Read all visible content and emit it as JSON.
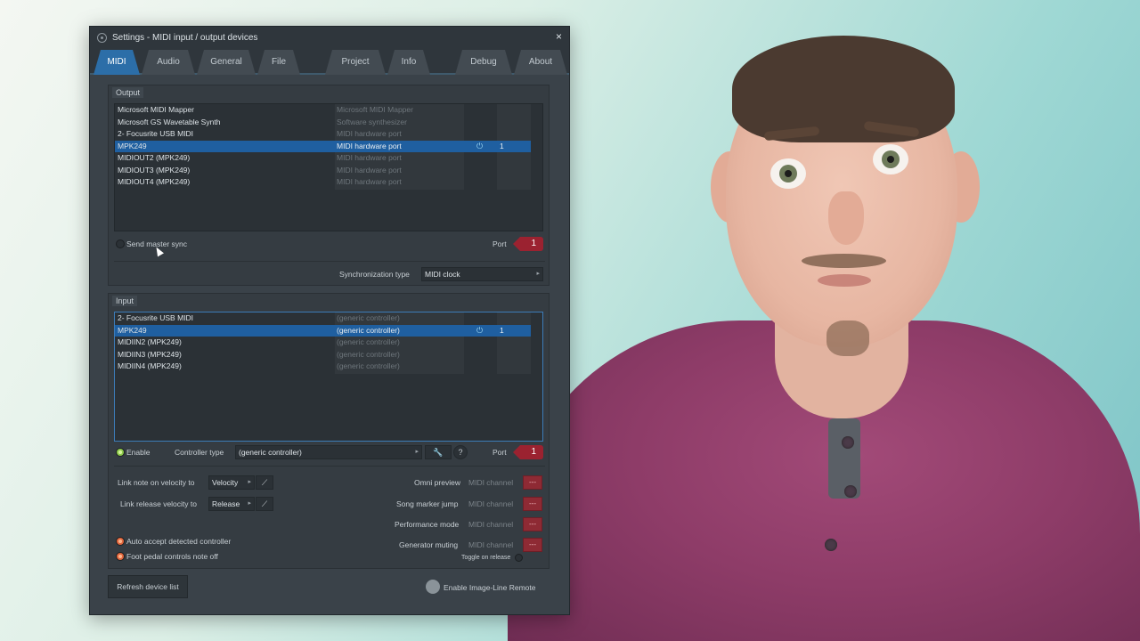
{
  "window": {
    "title": "Settings - MIDI input / output devices",
    "close_glyph": "×"
  },
  "tabs": [
    "MIDI",
    "Audio",
    "General",
    "File",
    "Project",
    "Info",
    "Debug",
    "About"
  ],
  "active_tab": "MIDI",
  "output": {
    "label": "Output",
    "devices": [
      {
        "name": "Microsoft MIDI Mapper",
        "type": "Microsoft MIDI Mapper"
      },
      {
        "name": "Microsoft GS Wavetable Synth",
        "type": "Software synthesizer"
      },
      {
        "name": "2- Focusrite USB MIDI",
        "type": "MIDI hardware port"
      },
      {
        "name": "MPK249",
        "type": "MIDI hardware port",
        "port": "1",
        "selected": true
      },
      {
        "name": "MIDIOUT2 (MPK249)",
        "type": "MIDI hardware port"
      },
      {
        "name": "MIDIOUT3 (MPK249)",
        "type": "MIDI hardware port"
      },
      {
        "name": "MIDIOUT4 (MPK249)",
        "type": "MIDI hardware port"
      }
    ],
    "send_master_sync": "Send master sync",
    "port_label": "Port",
    "port_value": "1",
    "sync_type_label": "Synchronization type",
    "sync_type_value": "MIDI clock"
  },
  "input": {
    "label": "Input",
    "devices": [
      {
        "name": "2- Focusrite USB MIDI",
        "type": "(generic controller)"
      },
      {
        "name": "MPK249",
        "type": "(generic controller)",
        "port": "1",
        "selected": true
      },
      {
        "name": "MIDIIN2 (MPK249)",
        "type": "(generic controller)"
      },
      {
        "name": "MIDIIN3 (MPK249)",
        "type": "(generic controller)"
      },
      {
        "name": "MIDIIN4 (MPK249)",
        "type": "(generic controller)"
      }
    ],
    "enable": "Enable",
    "controller_type_label": "Controller type",
    "controller_type_value": "(generic controller)",
    "help_glyph": "?",
    "port_label": "Port",
    "port_value": "1"
  },
  "options": {
    "link_note_label": "Link note on velocity to",
    "link_note_value": "Velocity",
    "link_release_label": "Link release velocity to",
    "link_release_value": "Release",
    "auto_accept": "Auto accept detected controller",
    "foot_pedal": "Foot pedal controls note off",
    "omni_preview": "Omni preview",
    "song_marker_jump": "Song marker jump",
    "performance_mode": "Performance mode",
    "generator_muting": "Generator muting",
    "midi_channel": "MIDI channel",
    "channel_value": "---",
    "toggle_on_release": "Toggle on release"
  },
  "footer": {
    "refresh": "Refresh device list",
    "enable_remote": "Enable Image-Line Remote"
  },
  "colors": {
    "accent": "#2c6ea8",
    "selection": "#1f5fa0",
    "port_red": "#9b2230"
  }
}
